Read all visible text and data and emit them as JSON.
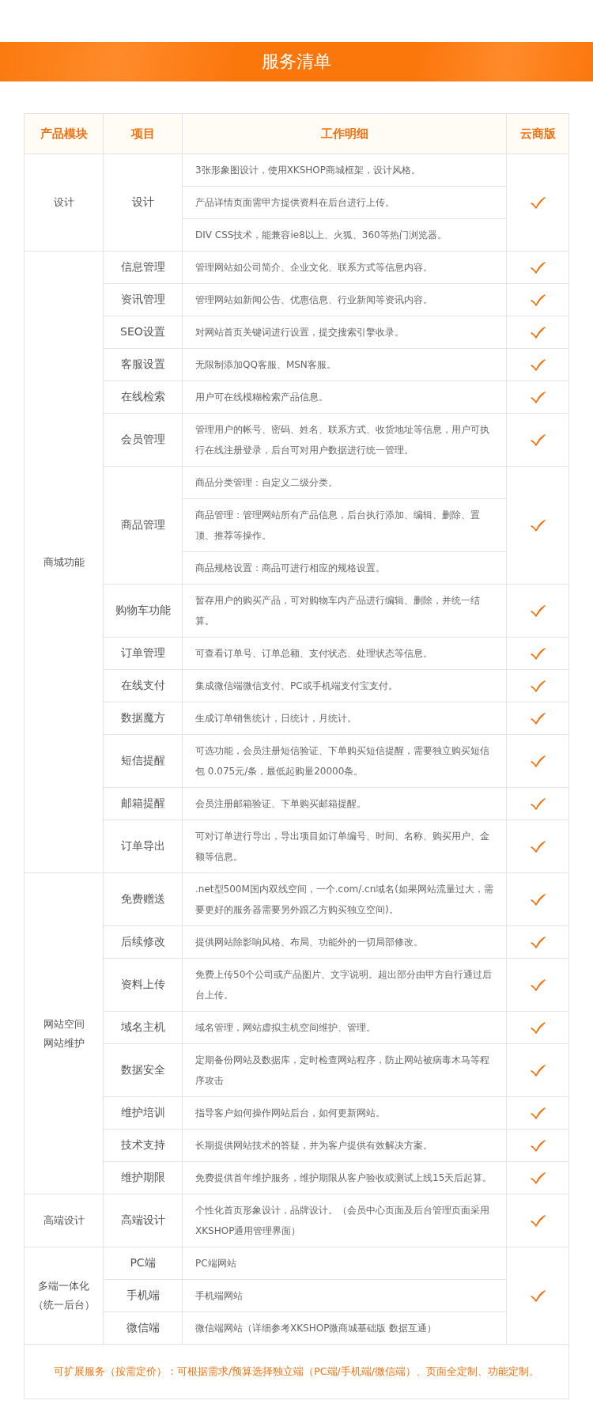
{
  "banner": {
    "title": "服务清单"
  },
  "table": {
    "columns": [
      "产品模块",
      "项目",
      "工作明细",
      "云商版"
    ],
    "groups": [
      {
        "module": [
          "设计"
        ],
        "items": [
          {
            "name": "设计",
            "checked": true,
            "details": [
              "3张形象图设计，使用XKSHOP商城框架，设计风格。",
              "产品详情页面需甲方提供资料在后台进行上传。",
              "DIV CSS技术，能兼容ie8以上、火狐、360等热门浏览器。"
            ]
          }
        ]
      },
      {
        "module": [
          "商城功能"
        ],
        "items": [
          {
            "name": "信息管理",
            "checked": true,
            "details": [
              "管理网站如公司简介、企业文化、联系方式等信息内容。"
            ]
          },
          {
            "name": "资讯管理",
            "checked": true,
            "details": [
              "管理网站如新闻公告、优惠信息、行业新闻等资讯内容。"
            ]
          },
          {
            "name": "SEO设置",
            "checked": true,
            "details": [
              "对网站首页关键词进行设置，提交搜索引擎收录。"
            ]
          },
          {
            "name": "客服设置",
            "checked": true,
            "details": [
              "无限制添加QQ客服、MSN客服。"
            ]
          },
          {
            "name": "在线检索",
            "checked": true,
            "details": [
              "用户可在线模糊检索产品信息。"
            ]
          },
          {
            "name": "会员管理",
            "checked": true,
            "details": [
              "管理用户的帐号、密码、姓名、联系方式、收货地址等信息，用户可执行在线注册登录，后台可对用户数据进行统一管理。"
            ]
          },
          {
            "name": "商品管理",
            "checked": true,
            "details": [
              "商品分类管理：自定义二级分类。",
              "商品管理：管理网站所有产品信息，后台执行添加、编辑、删除、置顶、推荐等操作。",
              "商品规格设置：商品可进行相应的规格设置。"
            ]
          },
          {
            "name": "购物车功能",
            "checked": true,
            "details": [
              "暂存用户的购买产品，可对购物车内产品进行编辑、删除，并统一结算。"
            ]
          },
          {
            "name": "订单管理",
            "checked": true,
            "details": [
              "可查看订单号、订单总额、支付状态、处理状态等信息。"
            ]
          },
          {
            "name": "在线支付",
            "checked": true,
            "details": [
              "集成微信端微信支付、PC或手机端支付宝支付。"
            ]
          },
          {
            "name": "数据魔方",
            "checked": true,
            "details": [
              "生成订单销售统计，日统计，月统计。"
            ]
          },
          {
            "name": "短信提醒",
            "checked": true,
            "details": [
              "可选功能，会员注册短信验证、下单购买短信提醒，需要独立购买短信包 0.075元/条，最低起购量20000条。"
            ]
          },
          {
            "name": "邮箱提醒",
            "checked": true,
            "details": [
              "会员注册邮箱验证、下单购买邮箱提醒。"
            ]
          },
          {
            "name": "订单导出",
            "checked": true,
            "details": [
              "可对订单进行导出，导出项目如订单编号、时间、名称、购买用户、金额等信息。"
            ]
          }
        ]
      },
      {
        "module": [
          "网站空间",
          "网站维护"
        ],
        "items": [
          {
            "name": "免费赠送",
            "checked": true,
            "details": [
              ".net型500M国内双线空间，一个.com/.cn域名(如果网站流量过大，需要更好的服务器需要另外跟乙方购买独立空间)。"
            ]
          },
          {
            "name": "后续修改",
            "checked": true,
            "details": [
              "提供网站除影响风格、布局、功能外的一切局部修改。"
            ]
          },
          {
            "name": "资料上传",
            "checked": true,
            "details": [
              "免费上传50个公司或产品图片、文字说明。超出部分由甲方自行通过后台上传。"
            ]
          },
          {
            "name": "域名主机",
            "checked": true,
            "details": [
              "域名管理，网站虚拟主机空间维护、管理。"
            ]
          },
          {
            "name": "数据安全",
            "checked": true,
            "details": [
              "定期备份网站及数据库，定时检查网站程序，防止网站被病毒木马等程序攻击"
            ]
          },
          {
            "name": "维护培训",
            "checked": true,
            "details": [
              "指导客户如何操作网站后台，如何更新网站。"
            ]
          },
          {
            "name": "技术支持",
            "checked": true,
            "details": [
              "长期提供网站技术的答疑，并为客户提供有效解决方案。"
            ]
          },
          {
            "name": "维护期限",
            "checked": true,
            "details": [
              "免费提供首年维护服务，维护期限从客户验收或测试上线15天后起算。"
            ]
          }
        ]
      },
      {
        "module": [
          "高端设计"
        ],
        "items": [
          {
            "name": "高端设计",
            "checked": true,
            "details": [
              "个性化首页形象设计，品牌设计。（会员中心页面及后台管理页面采用XKSHOP通用管理界面）"
            ]
          }
        ]
      },
      {
        "module": [
          "多端一体化",
          "（统一后台）"
        ],
        "checked": true,
        "items": [
          {
            "name": "PC端",
            "details": [
              "PC端网站"
            ]
          },
          {
            "name": "手机端",
            "details": [
              "手机端网站"
            ]
          },
          {
            "name": "微信端",
            "details": [
              "微信端网站（详细参考XKSHOP微商城基础版 数据互通）"
            ]
          }
        ]
      }
    ],
    "footer": "可扩展服务（按需定价）：可根据需求/预算选择独立端（PC端/手机端/微信端）、页面全定制、功能定制。"
  }
}
